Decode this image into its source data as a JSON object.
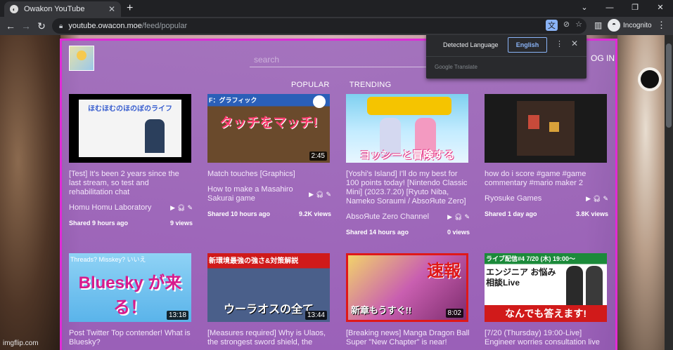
{
  "browser": {
    "tab_title": "Owakon YouTube",
    "url_host": "youtube.owacon.moe",
    "url_path": "/feed/popular",
    "incognito_label": "Incognito",
    "icons": [
      "back-icon",
      "forward-icon",
      "reload-icon",
      "lock-icon",
      "translate-icon",
      "eye-off-icon",
      "star-icon",
      "side-panel-icon",
      "menu-icon"
    ]
  },
  "translate_popup": {
    "detected": "Detected Language",
    "language": "English",
    "footer": "Google Translate"
  },
  "site": {
    "search_placeholder": "search",
    "login_label": "OG IN",
    "tabs": [
      "POPULAR",
      "TRENDING"
    ],
    "accent_color": "#e02bd6"
  },
  "videos": [
    {
      "title": "[Test] It's been 2 years since the last stream, so test and rehabilitation chat",
      "channel": "Homu Homu Laboratory",
      "shared": "Shared 9 hours ago",
      "views": "9 views",
      "duration": "",
      "thumb_text": "ほむほむのほのぼのライフ"
    },
    {
      "title": "Match touches [Graphics]",
      "channel": "How to make a Masahiro Sakurai game",
      "shared": "Shared 10 hours ago",
      "views": "9.2K views",
      "duration": "2:45",
      "thumb_text": "タッチをマッチ!",
      "thumb_tag": "F：グラフィック"
    },
    {
      "title": "[Yoshi's Island] I'll do my best for 100 points today! [Nintendo Classic Mini] (2023.7.20) [Ryuto Niba, Nameko Soraumi / AbsoЯute Zero]",
      "channel": "AbsoЯute Zero Channel",
      "shared": "Shared 14 hours ago",
      "views": "0 views",
      "duration": "",
      "thumb_text": "ヨッシーと冒険する"
    },
    {
      "title": "how do i score #game #game commentary #mario maker 2",
      "channel": "Ryosuke Games",
      "shared": "Shared 1 day ago",
      "views": "3.8K views",
      "duration": "",
      "thumb_text": ""
    },
    {
      "title": "Post Twitter Top contender! What is Bluesky?",
      "duration": "13:18",
      "thumb_text": "Bluesky が来る！",
      "thumb_tag": "Threads? Misskey? いいえ"
    },
    {
      "title": "[Measures required] Why is Ulaos, the strongest sword shield, the",
      "duration": "13:44",
      "thumb_text": "ウーラオスの全て",
      "thumb_tag": "新環境最強の強さ&対策解説"
    },
    {
      "title": "[Breaking news] Manga Dragon Ball Super \"New Chapter\" is near!",
      "duration": "8:02",
      "thumb_text": "新章もうすぐ!!",
      "thumb_tag": "速報"
    },
    {
      "title": "[7/20 (Thursday) 19:00-Live] Engineer worries consultation live",
      "duration": "",
      "thumb_text": "なんでも答えます!",
      "thumb_tag": "ライブ配信#4 7/20 (木) 19:00～",
      "thumb_tag2": "エンジニア お悩み相談Live"
    }
  ],
  "watermark": "imgflip.com"
}
